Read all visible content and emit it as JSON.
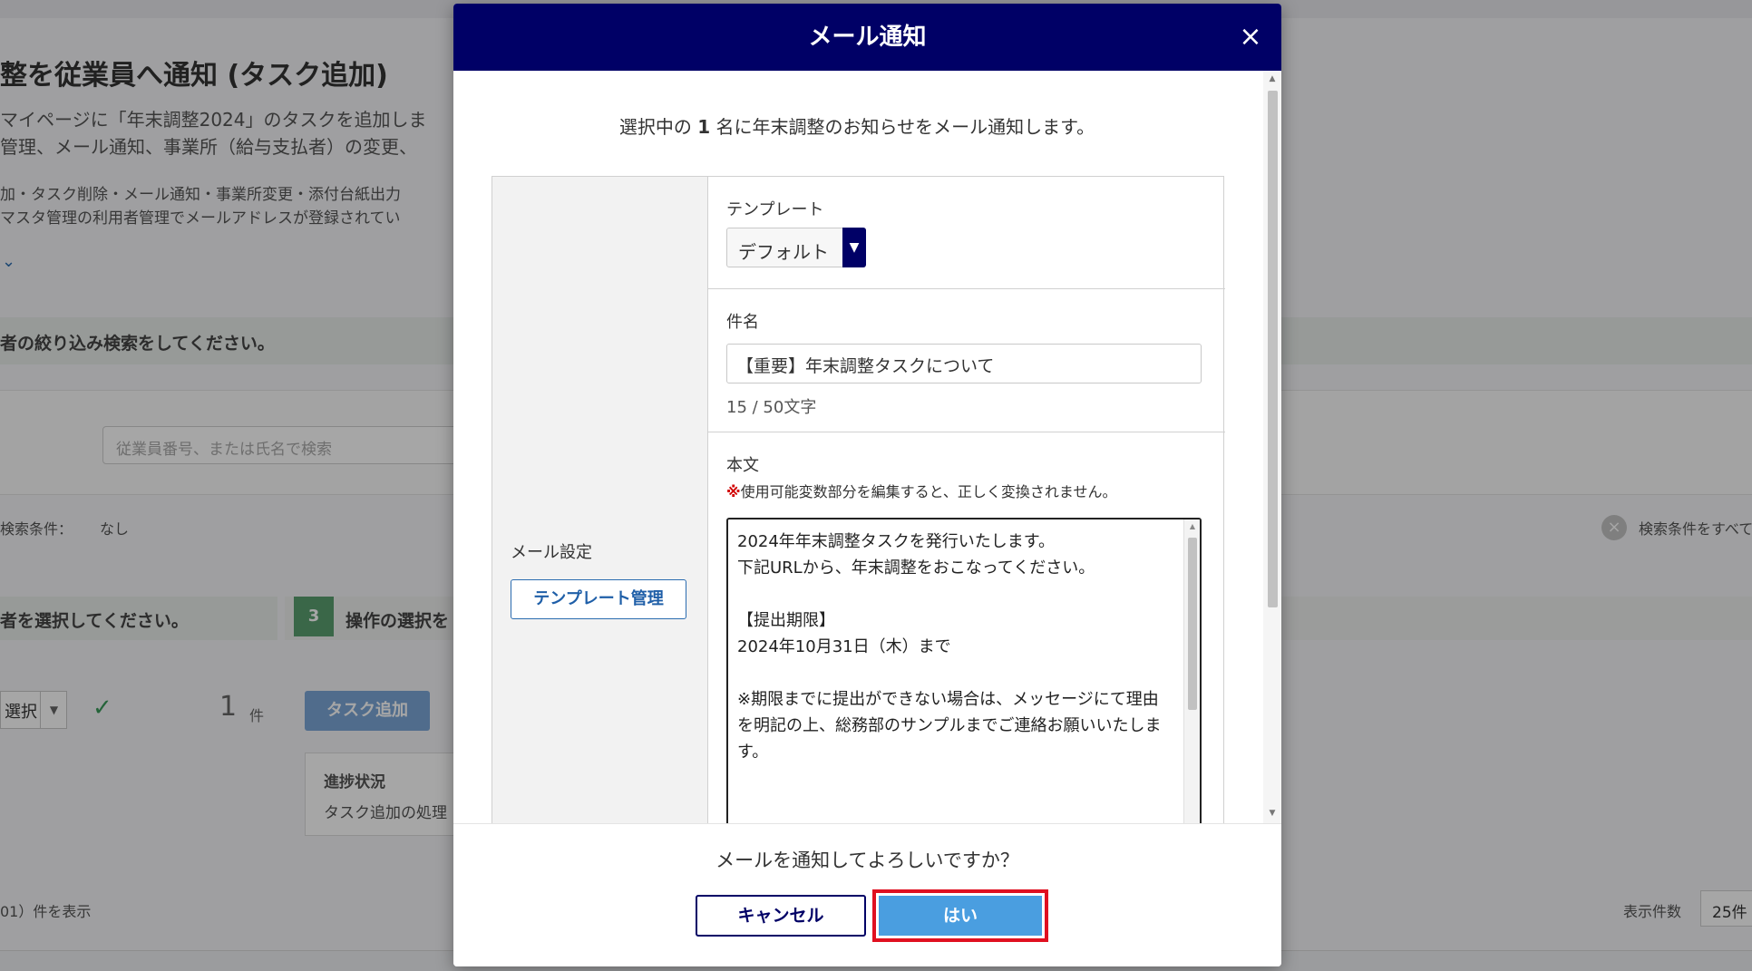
{
  "background": {
    "page_title": "整を従業員へ通知 (タスク追加)",
    "desc_line1": "マイページに「年末調整2024」のタスクを追加しま",
    "desc_line2": "管理、メール通知、事業所（給与支払者）の変更、",
    "note_line1": "加・タスク削除・メール通知・事業所変更・添付台紙出力",
    "note_line2": "マスタ管理の利用者管理でメールアドレスが登録されてい",
    "step_filter": "者の絞り込み検索をしてください。",
    "search_placeholder": "従業員番号、または氏名で検索",
    "search_condition_label": "検索条件：",
    "search_condition_value": "なし",
    "clear_conditions": "検索条件をすべて",
    "step_select": "者を選択してください。",
    "step3_number": "3",
    "step3_label": "操作の選択を",
    "select_label": "選択",
    "selected_count": "1",
    "selected_count_unit": "件",
    "task_add_button": "タスク追加",
    "progress_label": "進捗状況",
    "progress_text": "タスク追加の処理",
    "footer_left": "01）件を表示",
    "per_page_label": "表示件数",
    "per_page_value": "25件"
  },
  "modal": {
    "title": "メール通知",
    "close_symbol": "×",
    "intro_before": "選択中の ",
    "intro_count": "1",
    "intro_after": " 名に年末調整のお知らせをメール通知します。",
    "mail_settings_label": "メール設定",
    "template_manage_button": "テンプレート管理",
    "template": {
      "label": "テンプレート",
      "value": "デフォルト"
    },
    "subject": {
      "label": "件名",
      "value": "【重要】年末調整タスクについて",
      "char_count": "15 / 50文字"
    },
    "body": {
      "label": "本文",
      "warning_mark": "※",
      "warning_text": "使用可能変数部分を編集すると、正しく変換されません。",
      "text": "2024年年末調整タスクを発行いたします。\n下記URLから、年末調整をおこなってください。\n\n【提出期限】\n2024年10月31日（木）まで\n\n※期限までに提出ができない場合は、メッセージにて理由を明記の上、総務部のサンプルまでご連絡お願いいたします。"
    },
    "confirm_question": "メールを通知してよろしいですか？",
    "cancel_button": "キャンセル",
    "yes_button": "はい"
  },
  "colors": {
    "modal_header": "#000066",
    "primary_button": "#4a9ee0",
    "highlight_border": "#e01020",
    "warning": "#d10000"
  }
}
